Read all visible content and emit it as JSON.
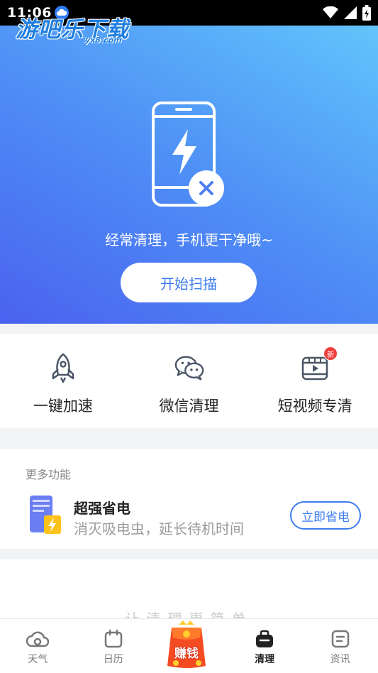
{
  "status_bar": {
    "time": "11:06"
  },
  "watermark": {
    "text": "游吧乐下载",
    "sub": "yx8.com"
  },
  "hero": {
    "tagline": "经常清理，手机更干净哦~",
    "scan_button": "开始扫描"
  },
  "quick_tools": [
    {
      "label": "一键加速",
      "icon": "rocket-icon"
    },
    {
      "label": "微信清理",
      "icon": "wechat-icon"
    },
    {
      "label": "短视频专清",
      "icon": "video-icon",
      "badge": "新"
    }
  ],
  "more": {
    "title": "更多功能",
    "feature": {
      "title": "超强省电",
      "description": "消灭吸电虫，延长待机时间",
      "button": "立即省电"
    }
  },
  "slogan": "让清理更简单",
  "bottom_nav": {
    "items": [
      {
        "label": "天气",
        "icon": "weather-cloud-icon"
      },
      {
        "label": "日历",
        "icon": "calendar-icon"
      },
      {
        "label": "清理",
        "icon": "clean-bag-icon",
        "active": true
      },
      {
        "label": "资讯",
        "icon": "news-icon"
      }
    ],
    "earn_label": "赚钱"
  },
  "colors": {
    "accent": "#3f7cf0",
    "hero_gradient_start": "#62c4fb",
    "hero_gradient_end": "#4a62f0",
    "badge_red": "#f0403c"
  }
}
